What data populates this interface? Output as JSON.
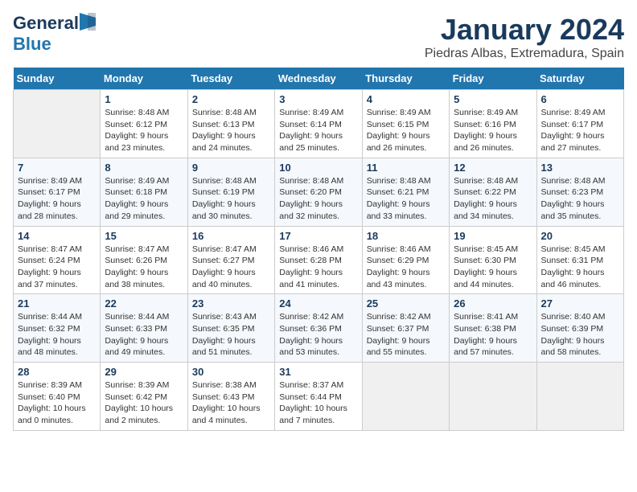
{
  "header": {
    "logo_general": "General",
    "logo_blue": "Blue",
    "title": "January 2024",
    "subtitle": "Piedras Albas, Extremadura, Spain"
  },
  "weekdays": [
    "Sunday",
    "Monday",
    "Tuesday",
    "Wednesday",
    "Thursday",
    "Friday",
    "Saturday"
  ],
  "weeks": [
    [
      {
        "day": "",
        "sunrise": "",
        "sunset": "",
        "daylight": ""
      },
      {
        "day": "1",
        "sunrise": "Sunrise: 8:48 AM",
        "sunset": "Sunset: 6:12 PM",
        "daylight": "Daylight: 9 hours and 23 minutes."
      },
      {
        "day": "2",
        "sunrise": "Sunrise: 8:48 AM",
        "sunset": "Sunset: 6:13 PM",
        "daylight": "Daylight: 9 hours and 24 minutes."
      },
      {
        "day": "3",
        "sunrise": "Sunrise: 8:49 AM",
        "sunset": "Sunset: 6:14 PM",
        "daylight": "Daylight: 9 hours and 25 minutes."
      },
      {
        "day": "4",
        "sunrise": "Sunrise: 8:49 AM",
        "sunset": "Sunset: 6:15 PM",
        "daylight": "Daylight: 9 hours and 26 minutes."
      },
      {
        "day": "5",
        "sunrise": "Sunrise: 8:49 AM",
        "sunset": "Sunset: 6:16 PM",
        "daylight": "Daylight: 9 hours and 26 minutes."
      },
      {
        "day": "6",
        "sunrise": "Sunrise: 8:49 AM",
        "sunset": "Sunset: 6:17 PM",
        "daylight": "Daylight: 9 hours and 27 minutes."
      }
    ],
    [
      {
        "day": "7",
        "sunrise": "Sunrise: 8:49 AM",
        "sunset": "Sunset: 6:17 PM",
        "daylight": "Daylight: 9 hours and 28 minutes."
      },
      {
        "day": "8",
        "sunrise": "Sunrise: 8:49 AM",
        "sunset": "Sunset: 6:18 PM",
        "daylight": "Daylight: 9 hours and 29 minutes."
      },
      {
        "day": "9",
        "sunrise": "Sunrise: 8:48 AM",
        "sunset": "Sunset: 6:19 PM",
        "daylight": "Daylight: 9 hours and 30 minutes."
      },
      {
        "day": "10",
        "sunrise": "Sunrise: 8:48 AM",
        "sunset": "Sunset: 6:20 PM",
        "daylight": "Daylight: 9 hours and 32 minutes."
      },
      {
        "day": "11",
        "sunrise": "Sunrise: 8:48 AM",
        "sunset": "Sunset: 6:21 PM",
        "daylight": "Daylight: 9 hours and 33 minutes."
      },
      {
        "day": "12",
        "sunrise": "Sunrise: 8:48 AM",
        "sunset": "Sunset: 6:22 PM",
        "daylight": "Daylight: 9 hours and 34 minutes."
      },
      {
        "day": "13",
        "sunrise": "Sunrise: 8:48 AM",
        "sunset": "Sunset: 6:23 PM",
        "daylight": "Daylight: 9 hours and 35 minutes."
      }
    ],
    [
      {
        "day": "14",
        "sunrise": "Sunrise: 8:47 AM",
        "sunset": "Sunset: 6:24 PM",
        "daylight": "Daylight: 9 hours and 37 minutes."
      },
      {
        "day": "15",
        "sunrise": "Sunrise: 8:47 AM",
        "sunset": "Sunset: 6:26 PM",
        "daylight": "Daylight: 9 hours and 38 minutes."
      },
      {
        "day": "16",
        "sunrise": "Sunrise: 8:47 AM",
        "sunset": "Sunset: 6:27 PM",
        "daylight": "Daylight: 9 hours and 40 minutes."
      },
      {
        "day": "17",
        "sunrise": "Sunrise: 8:46 AM",
        "sunset": "Sunset: 6:28 PM",
        "daylight": "Daylight: 9 hours and 41 minutes."
      },
      {
        "day": "18",
        "sunrise": "Sunrise: 8:46 AM",
        "sunset": "Sunset: 6:29 PM",
        "daylight": "Daylight: 9 hours and 43 minutes."
      },
      {
        "day": "19",
        "sunrise": "Sunrise: 8:45 AM",
        "sunset": "Sunset: 6:30 PM",
        "daylight": "Daylight: 9 hours and 44 minutes."
      },
      {
        "day": "20",
        "sunrise": "Sunrise: 8:45 AM",
        "sunset": "Sunset: 6:31 PM",
        "daylight": "Daylight: 9 hours and 46 minutes."
      }
    ],
    [
      {
        "day": "21",
        "sunrise": "Sunrise: 8:44 AM",
        "sunset": "Sunset: 6:32 PM",
        "daylight": "Daylight: 9 hours and 48 minutes."
      },
      {
        "day": "22",
        "sunrise": "Sunrise: 8:44 AM",
        "sunset": "Sunset: 6:33 PM",
        "daylight": "Daylight: 9 hours and 49 minutes."
      },
      {
        "day": "23",
        "sunrise": "Sunrise: 8:43 AM",
        "sunset": "Sunset: 6:35 PM",
        "daylight": "Daylight: 9 hours and 51 minutes."
      },
      {
        "day": "24",
        "sunrise": "Sunrise: 8:42 AM",
        "sunset": "Sunset: 6:36 PM",
        "daylight": "Daylight: 9 hours and 53 minutes."
      },
      {
        "day": "25",
        "sunrise": "Sunrise: 8:42 AM",
        "sunset": "Sunset: 6:37 PM",
        "daylight": "Daylight: 9 hours and 55 minutes."
      },
      {
        "day": "26",
        "sunrise": "Sunrise: 8:41 AM",
        "sunset": "Sunset: 6:38 PM",
        "daylight": "Daylight: 9 hours and 57 minutes."
      },
      {
        "day": "27",
        "sunrise": "Sunrise: 8:40 AM",
        "sunset": "Sunset: 6:39 PM",
        "daylight": "Daylight: 9 hours and 58 minutes."
      }
    ],
    [
      {
        "day": "28",
        "sunrise": "Sunrise: 8:39 AM",
        "sunset": "Sunset: 6:40 PM",
        "daylight": "Daylight: 10 hours and 0 minutes."
      },
      {
        "day": "29",
        "sunrise": "Sunrise: 8:39 AM",
        "sunset": "Sunset: 6:42 PM",
        "daylight": "Daylight: 10 hours and 2 minutes."
      },
      {
        "day": "30",
        "sunrise": "Sunrise: 8:38 AM",
        "sunset": "Sunset: 6:43 PM",
        "daylight": "Daylight: 10 hours and 4 minutes."
      },
      {
        "day": "31",
        "sunrise": "Sunrise: 8:37 AM",
        "sunset": "Sunset: 6:44 PM",
        "daylight": "Daylight: 10 hours and 7 minutes."
      },
      {
        "day": "",
        "sunrise": "",
        "sunset": "",
        "daylight": ""
      },
      {
        "day": "",
        "sunrise": "",
        "sunset": "",
        "daylight": ""
      },
      {
        "day": "",
        "sunrise": "",
        "sunset": "",
        "daylight": ""
      }
    ]
  ]
}
